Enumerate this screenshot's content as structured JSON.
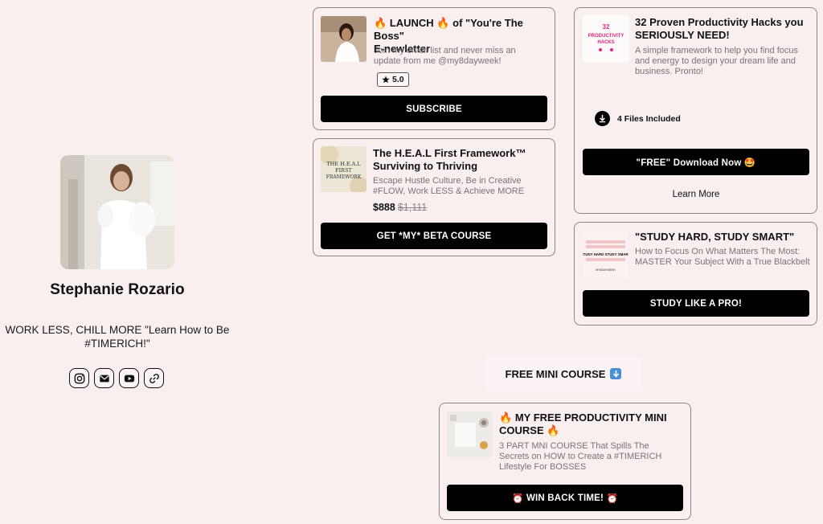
{
  "profile": {
    "name": "Stephanie Rozario",
    "bio_line1": "WORK LESS, CHILL MORE \"Learn How to Be",
    "bio_line2": "#TIMERICH!\""
  },
  "socials": [
    "instagram-icon",
    "email-icon",
    "youtube-icon",
    "link-icon"
  ],
  "cards": {
    "newsletter": {
      "title_pre": "LAUNCH",
      "title_post": "of \"You're The Boss\"",
      "title_line2": "E-newletter",
      "desc": "Join my email list and never miss an update from me @my8dayweek!",
      "rating": "5.0",
      "button": "SUBSCRIBE"
    },
    "heal": {
      "title": "The H.E.A.L First Framework™ Surviving to Thriving",
      "desc": "Escape Hustle Culture, Be in Creative #FLOW, Work LESS & Achieve MORE",
      "price": "$888",
      "old_price": "$1,111",
      "button": "GET *MY* BETA COURSE",
      "thumb_text": "THE H.E.A.L FIRST FRAMEWORK"
    },
    "hacks": {
      "title": "32 Proven Productivity Hacks you SERIOUSLY NEED!",
      "desc": "A simple framework to help you find focus and energy to design your dream life and business. Pronto!",
      "files": "4 Files Included",
      "button": "\"FREE\" Download Now 🤩",
      "link": "Learn More",
      "thumb_num": "32",
      "thumb_text": "PRODUCTIVITY HACKS"
    },
    "study": {
      "title": "\"STUDY HARD, STUDY SMART\"",
      "desc": "How to Focus On What Matters The Most: MASTER Your Subject With a True Blackbelt",
      "button": "STUDY LIKE A PRO!",
      "thumb_text": "STUDY HARD STUDY SMART"
    },
    "mini": {
      "title": "MY FREE PRODUCTIVITY MINI COURSE",
      "desc": "3 PART MNI COURSE That Spills The Secrets on HOW to Create a #TIMERICH Lifestyle For BOSSES",
      "button": "WIN BACK TIME!"
    }
  },
  "section": {
    "title": "FREE MINI COURSE"
  },
  "colors": {
    "background": "#f9efef",
    "button": "#000000",
    "border": "#8f8586",
    "accent_pink": "#e0287a"
  }
}
